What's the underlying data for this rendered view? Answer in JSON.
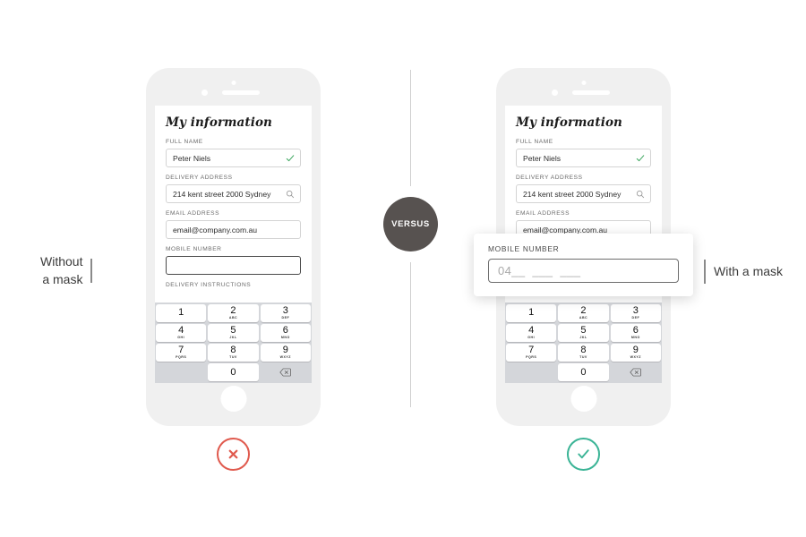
{
  "comparison": {
    "left_caption_line1": "Without",
    "left_caption_line2": "a mask",
    "right_caption": "With a mask",
    "versus_label": "VERSUS",
    "bad_icon": "circle-x-icon",
    "good_icon": "circle-check-icon",
    "bad_color": "#e05a4e",
    "good_color": "#3bb496",
    "versus_color": "#575250"
  },
  "form": {
    "title": "My information",
    "fields": [
      {
        "label": "FULL NAME",
        "value": "Peter Niels",
        "placeholder": "",
        "adornment": "check-icon",
        "adornment_color": "#3aa55c",
        "focused": false
      },
      {
        "label": "DELIVERY ADDRESS",
        "value": "214 kent street 2000 Sydney",
        "placeholder": "",
        "adornment": "search-icon",
        "adornment_color": "#9a9a9a",
        "focused": false
      },
      {
        "label": "EMAIL ADDRESS",
        "value": "email@company.com.au",
        "placeholder": "",
        "adornment": "",
        "adornment_color": "",
        "focused": false
      }
    ],
    "mobile_label": "MOBILE NUMBER",
    "mobile_value_unmasked": "",
    "mobile_mask": "04__  ___  ___",
    "next_label": "DELIVERY INSTRUCTIONS"
  },
  "keypad": {
    "keys": [
      {
        "num": "1",
        "sub": ""
      },
      {
        "num": "2",
        "sub": "ABC"
      },
      {
        "num": "3",
        "sub": "DEF"
      },
      {
        "num": "4",
        "sub": "GHI"
      },
      {
        "num": "5",
        "sub": "JKL"
      },
      {
        "num": "6",
        "sub": "MNO"
      },
      {
        "num": "7",
        "sub": "PQRS"
      },
      {
        "num": "8",
        "sub": "TUV"
      },
      {
        "num": "9",
        "sub": "WXYZ"
      },
      {
        "num": "0",
        "sub": ""
      }
    ],
    "delete_icon": "backspace-icon"
  }
}
